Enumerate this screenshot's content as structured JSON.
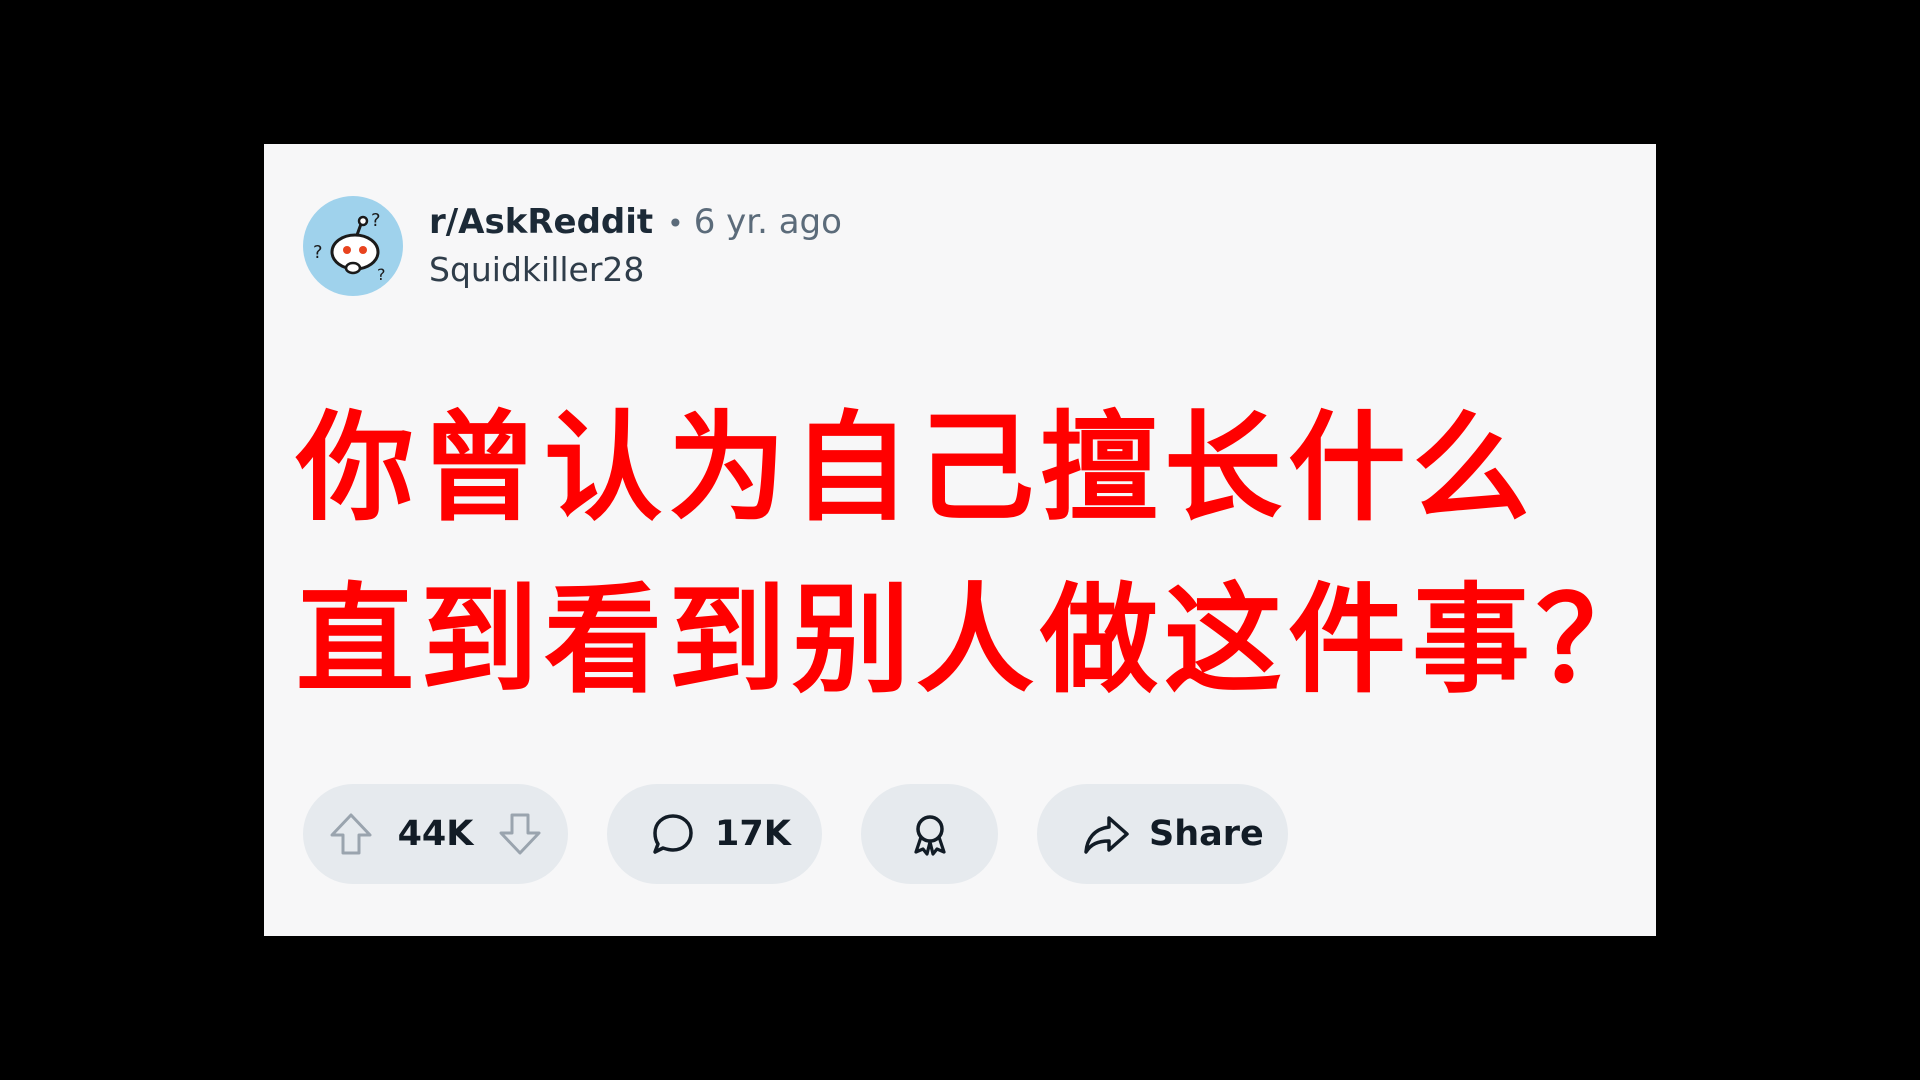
{
  "post": {
    "subreddit": "r/AskReddit",
    "separator": "•",
    "age": "6 yr. ago",
    "author": "Squidkiller28",
    "title_line1": "你曾认为自己擅长什么",
    "title_line2": "直到看到别人做这件事？"
  },
  "actions": {
    "upvote_icon": "arrow-up-icon",
    "score": "44K",
    "downvote_icon": "arrow-down-icon",
    "comment_icon": "speech-bubble-icon",
    "comments": "17K",
    "award_icon": "award-ribbon-icon",
    "share_icon": "share-arrow-icon",
    "share_label": "Share"
  },
  "colors": {
    "background": "#000000",
    "card": "#f7f7f8",
    "title": "#ff0000",
    "pill": "#e6eaee",
    "avatar": "#9fd2ec"
  }
}
